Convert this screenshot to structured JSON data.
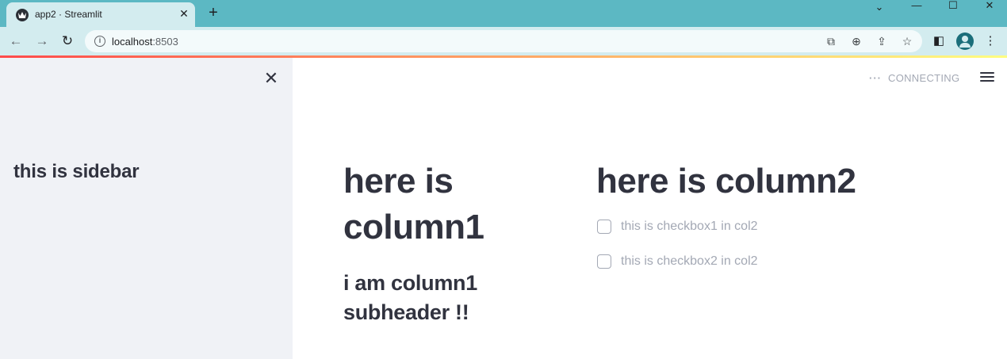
{
  "browser": {
    "tab_title": "app2 · Streamlit",
    "url_host": "localhost",
    "url_port": ":8503"
  },
  "sidebar": {
    "text": "this is sidebar"
  },
  "main": {
    "status": "CONNECTING",
    "col1": {
      "header_line1": "here is",
      "header_line2": "column1",
      "subheader_line1": "i am column1",
      "subheader_line2": "subheader !!"
    },
    "col2": {
      "header": "here is column2",
      "checkboxes": [
        {
          "label": "this is checkbox1 in col2",
          "checked": false
        },
        {
          "label": "this is checkbox2 in col2",
          "checked": false
        }
      ]
    }
  },
  "icons": {
    "favicon": "streamlit-crown-icon",
    "close": "close-icon",
    "menu": "hamburger-menu-icon"
  },
  "colors": {
    "accent": "#ff4b4b",
    "text": "#31333f",
    "muted": "#a3a8b4",
    "sidebar_bg": "#f0f2f6",
    "chrome": "#5cb8c3"
  }
}
